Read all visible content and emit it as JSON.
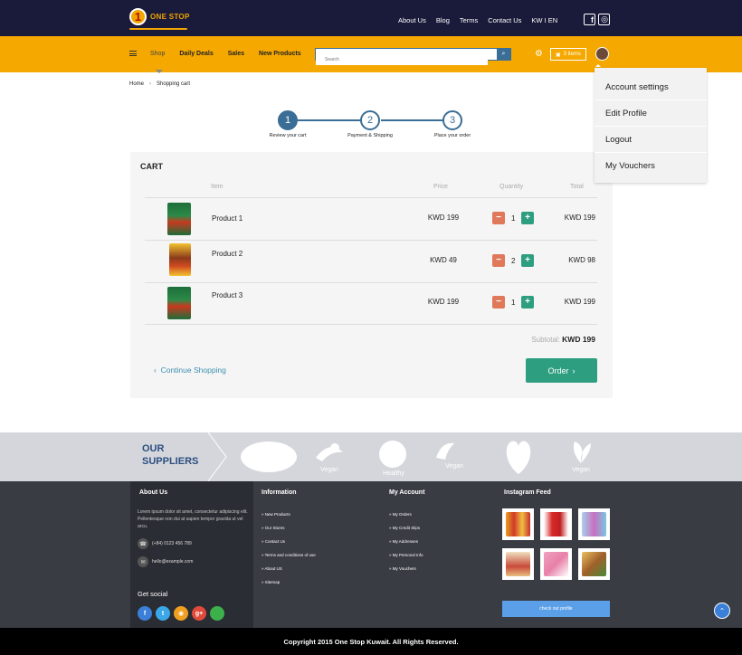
{
  "brand": {
    "logo_number": "1",
    "logo_text": "ONE STOP"
  },
  "topnav": {
    "items": [
      "About Us",
      "Blog",
      "Terms",
      "Contact Us",
      "KW I EN"
    ]
  },
  "mainnav": {
    "items": [
      "Shop",
      "Daily Deals",
      "Sales",
      "New Products"
    ],
    "search_placeholder": "Search",
    "cart_label": "3 items"
  },
  "account_menu": {
    "items": [
      "Account settings",
      "Edit Profile",
      "Logout",
      "My Vouchers"
    ]
  },
  "breadcrumb": {
    "home": "Home",
    "current": "Shopping cart"
  },
  "steps": [
    {
      "number": "1",
      "label": "Review your cart"
    },
    {
      "number": "2",
      "label": "Payment & Shipping"
    },
    {
      "number": "3",
      "label": "Place your order"
    }
  ],
  "cart": {
    "title": "CART",
    "columns": {
      "item": "Item",
      "price": "Price",
      "quantity": "Quantity",
      "total": "Total"
    },
    "rows": [
      {
        "name": "Product 1",
        "price": "KWD 199",
        "qty": "1",
        "total": "KWD 199"
      },
      {
        "name": "Product 2",
        "price": "KWD 49",
        "qty": "2",
        "total": "KWD 98"
      },
      {
        "name": "Product 3",
        "price": "KWD 199",
        "qty": "1",
        "total": "KWD 199"
      }
    ],
    "subtotal_label": "Subtotal:",
    "subtotal_value": "KWD 199",
    "continue_label": "Continue Shopping",
    "order_label": "Order"
  },
  "suppliers": {
    "title_line1": "OUR",
    "title_line2": "SUPPLIERS",
    "logos": [
      "Vegan",
      "Healthy",
      "Vegan",
      "Vegan"
    ]
  },
  "footer": {
    "about": {
      "heading": "About Us",
      "text": "Lorem ipsum dolor sit amet, consectetur adipiscing elit. Pellentesque non dui at sapien tempor gravida ut vel arcu.",
      "phone": "(+84) 0123 456 789",
      "email": "hello@example.com",
      "social_heading": "Get social"
    },
    "information": {
      "heading": "Information",
      "links": [
        "» New Products",
        "» Our Stores",
        "» Contact Us",
        "» Terms and conditions of use",
        "» About US",
        "» Sitemap"
      ]
    },
    "account": {
      "heading": "My Account",
      "links": [
        "» My Orders",
        "» My Credit Slips",
        "» My Addresses",
        "» My Personal Info",
        "» My Vouchers"
      ]
    },
    "instagram": {
      "heading": "Instagram Feed",
      "button": "check out profile"
    }
  },
  "copyright": "Copyright 2015 One Stop Kuwait. All Rights Reserved.",
  "colors": {
    "topbar": "#1a1a3a",
    "accent_orange": "#f5a800",
    "primary_blue": "#3b6e96",
    "order_green": "#2e9e80",
    "minus_orange": "#e0785a"
  }
}
